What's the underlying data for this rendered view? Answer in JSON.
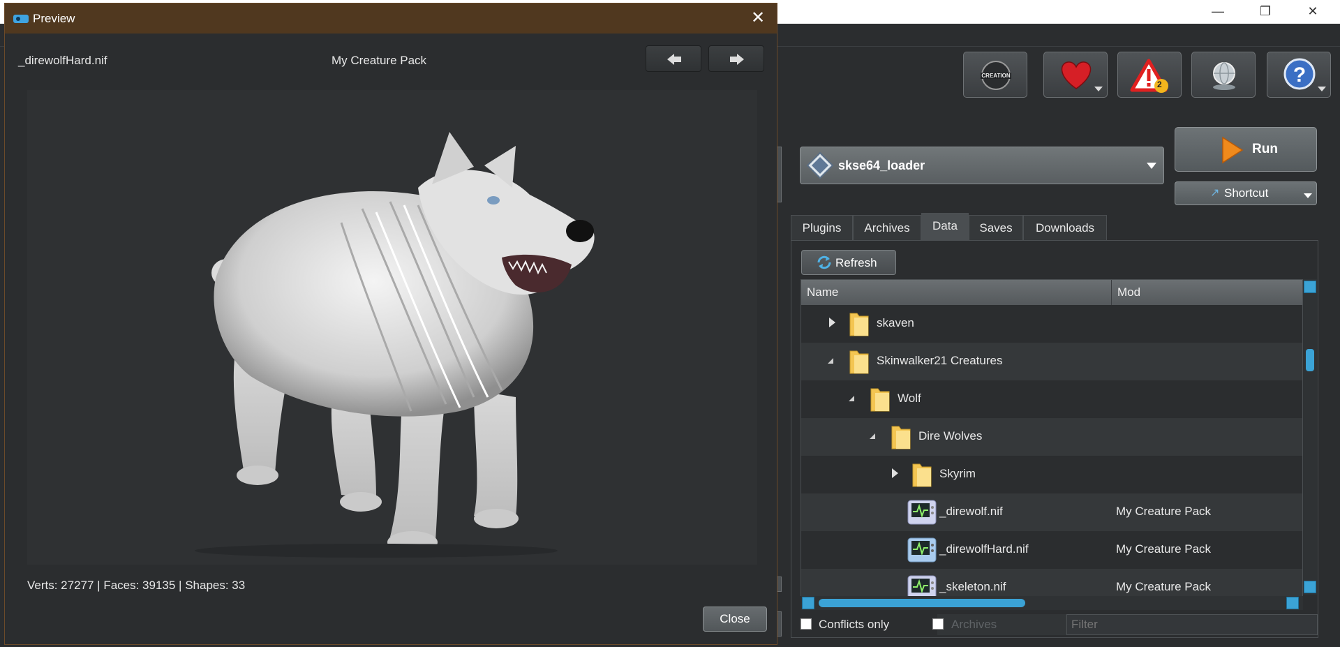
{
  "preview": {
    "title": "Preview",
    "close_glyph": "✕",
    "file_name": "_direwolfHard.nif",
    "mod_name": "My Creature Pack",
    "stats": "Verts: 27277 | Faces: 39135 | Shapes: 33",
    "close_label": "Close"
  },
  "toolbar": {
    "warnings_badge": "2"
  },
  "executable": {
    "selected": "skse64_loader"
  },
  "run": {
    "label": "Run",
    "shortcut_label": "Shortcut"
  },
  "tabs": [
    "Plugins",
    "Archives",
    "Data",
    "Saves",
    "Downloads"
  ],
  "active_tab": "Data",
  "data_tab": {
    "refresh_label": "Refresh",
    "columns": [
      "Name",
      "Mod"
    ],
    "rows": [
      {
        "name": "skaven",
        "mod": "",
        "type": "folder",
        "expanded": false,
        "depth": 0
      },
      {
        "name": "Skinwalker21 Creatures",
        "mod": "",
        "type": "folder",
        "expanded": true,
        "depth": 0
      },
      {
        "name": "Wolf",
        "mod": "",
        "type": "folder",
        "expanded": true,
        "depth": 1
      },
      {
        "name": "Dire Wolves",
        "mod": "",
        "type": "folder",
        "expanded": true,
        "depth": 2
      },
      {
        "name": "Skyrim",
        "mod": "",
        "type": "folder",
        "expanded": false,
        "depth": 3
      },
      {
        "name": "_direwolf.nif",
        "mod": "My Creature Pack",
        "type": "nif",
        "depth": 4
      },
      {
        "name": "_direwolfHard.nif",
        "mod": "My Creature Pack",
        "type": "nif",
        "depth": 4
      },
      {
        "name": "_skeleton.nif",
        "mod": "My Creature Pack",
        "type": "nif",
        "depth": 4
      }
    ],
    "conflicts_only_label": "Conflicts only",
    "archives_label": "Archives",
    "filter_placeholder": "Filter"
  },
  "colors": {
    "accent": "#3ba3d6",
    "dialog_title_bar": "#50381f",
    "run_arrow": "#f08a1c",
    "heart": "#d61f26",
    "warning": "#e02020"
  }
}
